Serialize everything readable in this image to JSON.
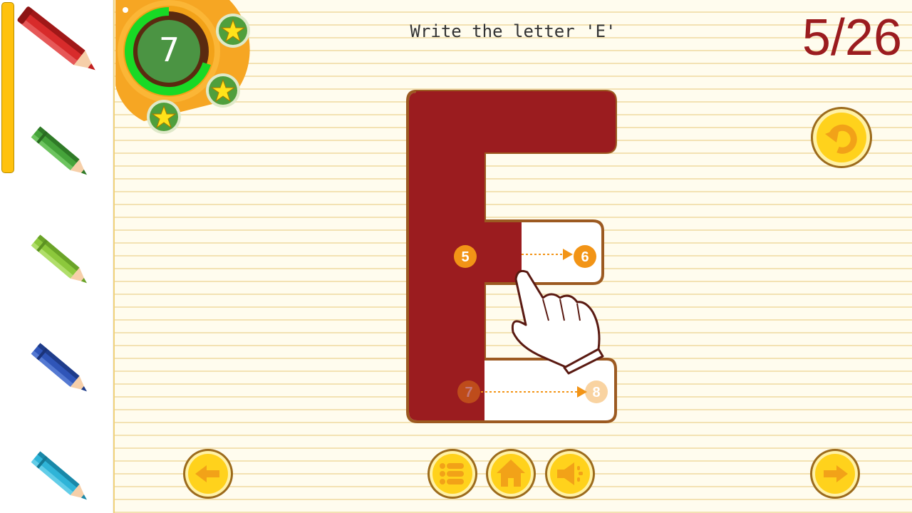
{
  "instruction": "Write the letter 'E'",
  "progress": "5/26",
  "timer": {
    "value": "7",
    "remaining_fraction": 0.7
  },
  "stars": {
    "count": 3
  },
  "pencils": [
    "red",
    "dark-green",
    "light-green",
    "blue",
    "cyan"
  ],
  "colors": {
    "letter_fill": "#9b1c1f",
    "letter_outline": "#9c5a21",
    "accent_orange": "#f29416",
    "button_gold": "#ffd21c",
    "timer_green": "#18d925"
  },
  "stroke_markers": {
    "start": "5",
    "end": "6",
    "next_start": "7",
    "next_end": "8"
  },
  "buttons": {
    "undo": "undo-icon",
    "previous": "previous-icon",
    "menu": "list-icon",
    "home": "home-icon",
    "sound": "speaker-icon",
    "next": "next-icon"
  }
}
